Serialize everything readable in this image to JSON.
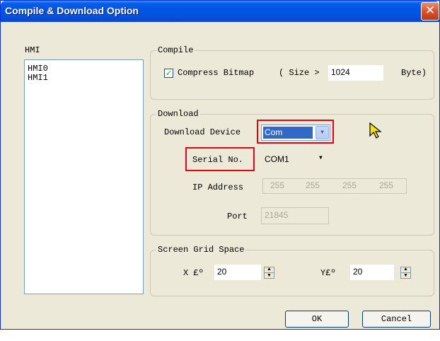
{
  "window": {
    "title": "Compile & Download Option",
    "close_icon": "close-icon"
  },
  "hmi": {
    "label": "HMI",
    "items": [
      "HMI0",
      "HMI1"
    ]
  },
  "compile": {
    "legend": "Compile",
    "compress_label": "Compress Bitmap",
    "compress_checked": true,
    "size_label": "( Size >",
    "size_value": "1024",
    "unit": "Byte)"
  },
  "download": {
    "legend": "Download",
    "device_label": "Download Device",
    "device_value": "Com",
    "serial_label": "Serial No.",
    "serial_value": "COM1",
    "ip_label": "IP Address",
    "ip_segments": [
      "255",
      "255",
      "255",
      "255"
    ],
    "port_label": "Port",
    "port_value": "21845"
  },
  "grid": {
    "legend": "Screen Grid Space",
    "x_label": "X £º",
    "x_value": "20",
    "y_label": "Y£º",
    "y_value": "20"
  },
  "buttons": {
    "ok": "OK",
    "cancel": "Cancel"
  },
  "colors": {
    "highlight": "#e60012",
    "title_bar": "#0054e3",
    "selection": "#316ac5"
  }
}
